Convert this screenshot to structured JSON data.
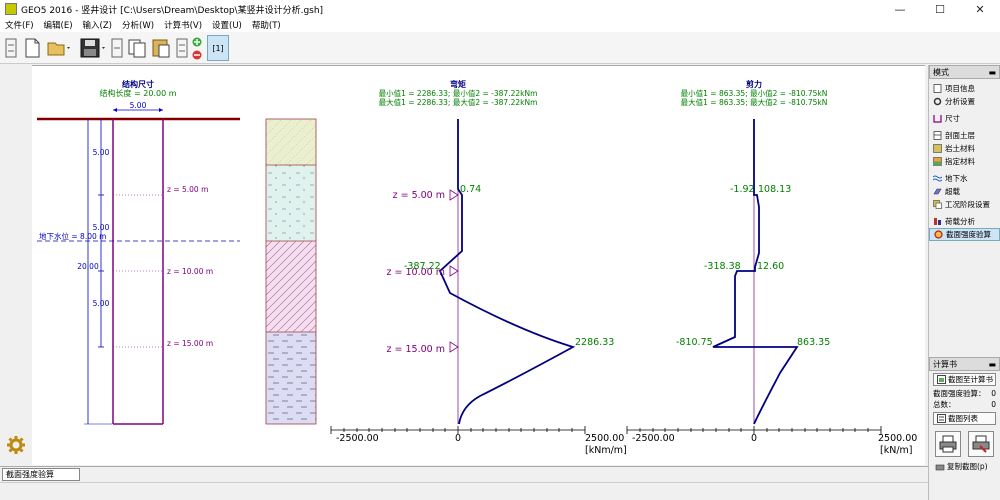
{
  "window": {
    "title": "GEO5 2016 - 竖井设计 [C:\\Users\\Dream\\Desktop\\某竖井设计分析.gsh]",
    "minimize": "—",
    "maximize": "☐",
    "close": "✕"
  },
  "menu": [
    "文件(F)",
    "编辑(E)",
    "输入(Z)",
    "分析(W)",
    "计算书(V)",
    "设置(U)",
    "帮助(T)"
  ],
  "toolbar": {
    "stage_label": "[1]"
  },
  "structure": {
    "title": "结构尺寸",
    "subtitle": "结构长度 = 20.00 m",
    "width_label": "5.00",
    "seg_labels": [
      "5.00",
      "5.00",
      "5.00"
    ],
    "total_label": "20.00",
    "gwt_label": "地下水位 = 8.00 m",
    "z_labels": [
      "z = 5.00 m",
      "z = 10.00 m",
      "z = 15.00 m"
    ]
  },
  "moment": {
    "title": "弯矩",
    "line1": "最小值1 = 2286.33; 最小值2 = -387.22kNm",
    "line2": "最大值1 = 2286.33; 最大值2 = -387.22kNm",
    "z_labels": [
      "z = 5.00 m",
      "z = 10.00 m",
      "z = 15.00 m"
    ],
    "value_labels": [
      "0.74",
      "-387.22",
      "2286.33"
    ],
    "axis_min": "-2500.00",
    "axis_zero": "0",
    "axis_max": "2500.00",
    "unit": "[kNm/m]"
  },
  "shear": {
    "title": "剪力",
    "line1": "最小值1 = 863.35; 最小值2 = -810.75kN",
    "line2": "最大值1 = 863.35; 最大值2 = -810.75kN",
    "value_labels": [
      "-1.92",
      "108.13",
      "-318.38",
      "12.60",
      "-810.75",
      "863.35"
    ],
    "axis_min": "-2500.00",
    "axis_zero": "0",
    "axis_max": "2500.00",
    "unit": "[kN/m]"
  },
  "right_panel": {
    "header": "模式",
    "items": [
      "项目信息",
      "分析设置",
      "尺寸",
      "剖面土层",
      "岩土材料",
      "指定材料",
      "地下水",
      "超载",
      "工况阶段设置",
      "荷载分析",
      "截面强度验算"
    ],
    "report_header": "计算书",
    "report_btn": "截图至计算书",
    "rows": [
      [
        "截面强度验算：",
        "0"
      ],
      [
        "总数：",
        "0"
      ]
    ],
    "list_btn": "截图列表",
    "copy_label": "复制截图(p)"
  },
  "status": {
    "tab": "截面强度验算"
  },
  "colors": {
    "accent": "#cde4f7",
    "diagram": "#000080",
    "label": "#008000",
    "purple": "#800080"
  }
}
